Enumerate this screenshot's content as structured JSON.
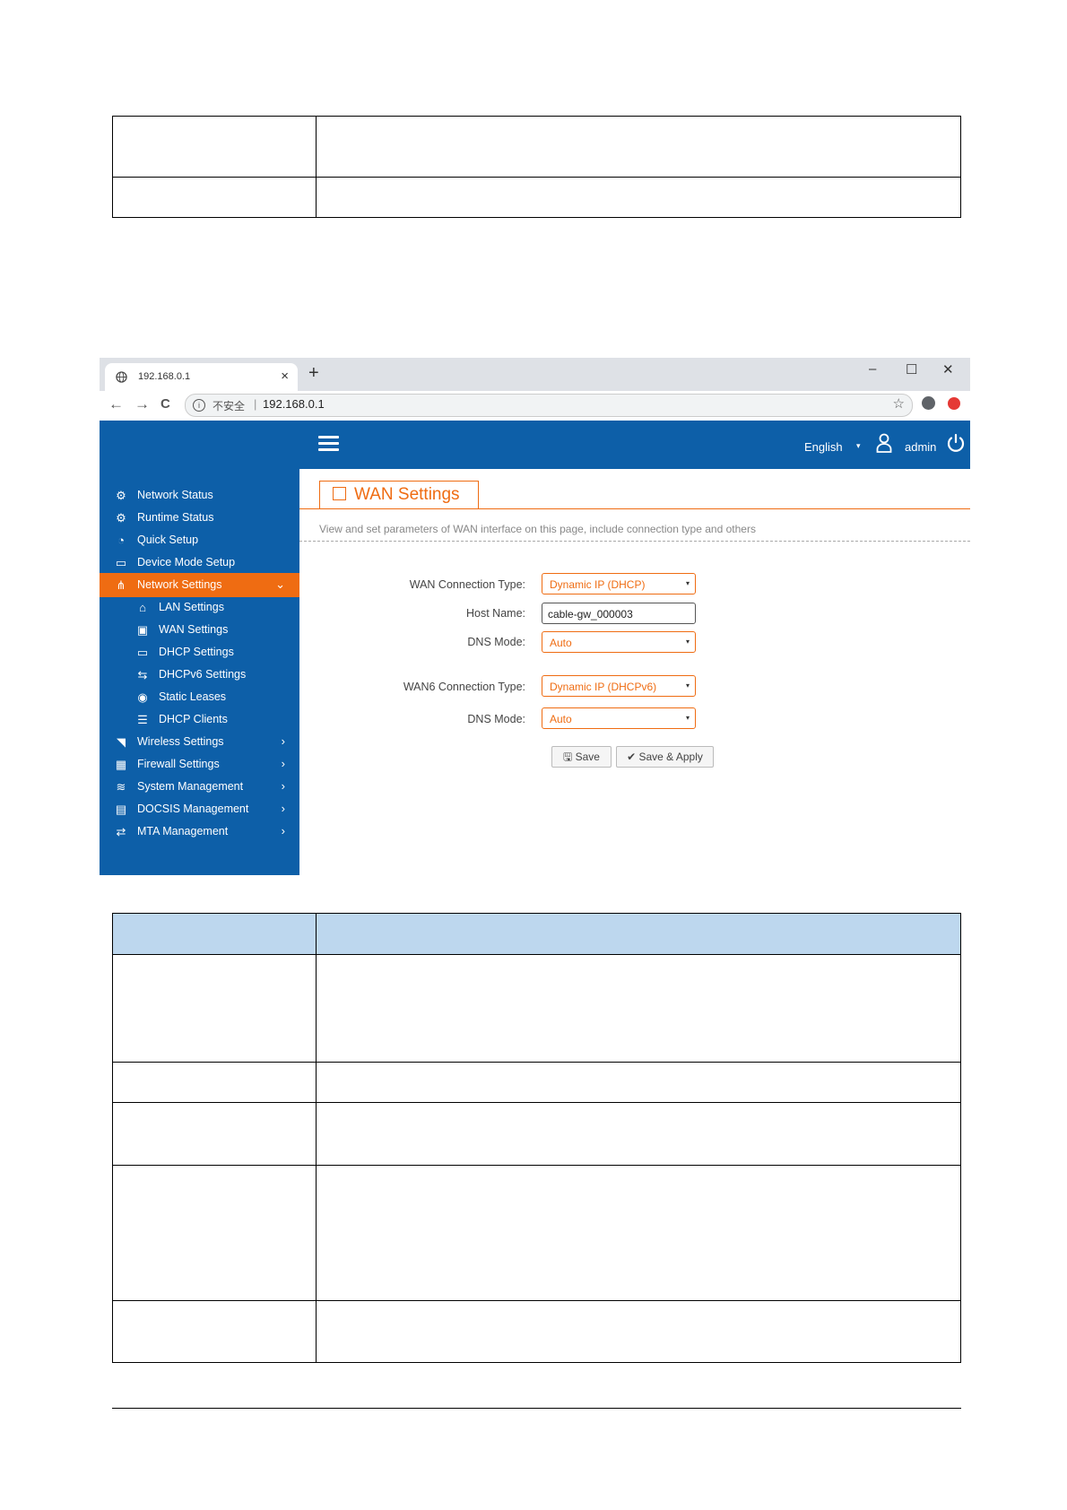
{
  "browser": {
    "tab_title": "192.168.0.1",
    "tab_close": "×",
    "new_tab": "+",
    "minimize": "–",
    "maximize": "☐",
    "close": "✕",
    "back": "←",
    "forward": "→",
    "reload": "C",
    "info": "i",
    "insecure_label": "不安全",
    "separator": "|",
    "url": "192.168.0.1",
    "bookmark": "☆"
  },
  "header": {
    "language": "English",
    "language_caret": "▾",
    "user": "admin"
  },
  "sidebar": {
    "items": [
      {
        "label": "Network Status",
        "icon": "⚙",
        "chevron": ""
      },
      {
        "label": "Runtime Status",
        "icon": "⚙",
        "chevron": ""
      },
      {
        "label": "Quick Setup",
        "icon": "◔",
        "chevron": ""
      },
      {
        "label": "Device Mode Setup",
        "icon": "▭",
        "chevron": ""
      },
      {
        "label": "Network Settings",
        "icon": "⋔",
        "chevron": "⌄"
      },
      {
        "label": "LAN Settings",
        "icon": "⌂",
        "chevron": ""
      },
      {
        "label": "WAN Settings",
        "icon": "▣",
        "chevron": ""
      },
      {
        "label": "DHCP Settings",
        "icon": "▭",
        "chevron": ""
      },
      {
        "label": "DHCPv6 Settings",
        "icon": "⇆",
        "chevron": ""
      },
      {
        "label": "Static Leases",
        "icon": "◉",
        "chevron": ""
      },
      {
        "label": "DHCP Clients",
        "icon": "☰",
        "chevron": ""
      },
      {
        "label": "Wireless Settings",
        "icon": "◥",
        "chevron": "›"
      },
      {
        "label": "Firewall Settings",
        "icon": "▦",
        "chevron": "›"
      },
      {
        "label": "System Management",
        "icon": "≋",
        "chevron": "›"
      },
      {
        "label": "DOCSIS Management",
        "icon": "▤",
        "chevron": "›"
      },
      {
        "label": "MTA Management",
        "icon": "⇄",
        "chevron": "›"
      }
    ]
  },
  "page": {
    "title": "WAN Settings",
    "description": "View and set parameters of WAN interface on this page, include connection type and others",
    "fields": {
      "wan_type_label": "WAN Connection Type:",
      "wan_type_value": "Dynamic IP (DHCP)",
      "host_label": "Host Name:",
      "host_value": "cable-gw_000003",
      "dns_label": "DNS Mode:",
      "dns_value": "Auto",
      "wan6_type_label": "WAN6 Connection Type:",
      "wan6_type_value": "Dynamic IP (DHCPv6)",
      "dns6_label": "DNS Mode:",
      "dns6_value": "Auto",
      "select_arrow": "▾"
    },
    "buttons": {
      "save": "🖫 Save",
      "save_apply": "✔ Save & Apply"
    }
  },
  "colors": {
    "primary": "#0d5fa8",
    "accent": "#ef6c12",
    "table_header": "#bdd7ee"
  }
}
